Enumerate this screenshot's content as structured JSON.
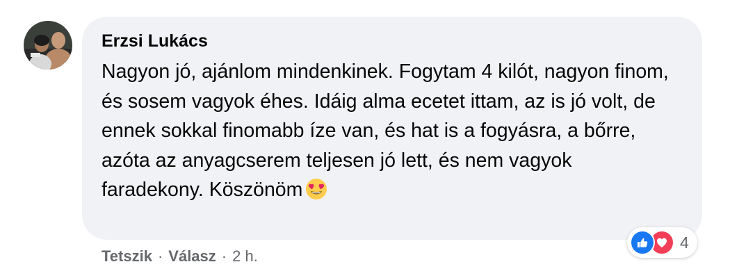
{
  "comment": {
    "author": "Erzsi Lukács",
    "text": "Nagyon jó, ajánlom mindenkinek. Fogytam 4 kilót, nagyon finom, és sosem vagyok éhes. Idáig alma ecetet ittam, az is jó volt, de ennek sokkal finomabb íze van, és hat is a fogyásra, a bőrre, azóta az anyagcserem teljesen jó lett, és nem vagyok faradekony. Köszönöm",
    "emoji_icon": "heart-eyes-emoji-icon"
  },
  "actions": {
    "like_label": "Tetszik",
    "reply_label": "Válasz",
    "separator": "·",
    "time": "2 h."
  },
  "reactions": {
    "icons": [
      "like-icon",
      "love-icon"
    ],
    "count": "4",
    "like_color": "#1877f2",
    "love_color": "#f33e58"
  },
  "colors": {
    "bubble_bg": "#f0f2f5",
    "secondary_text": "#65676b",
    "primary_text": "#050505"
  }
}
